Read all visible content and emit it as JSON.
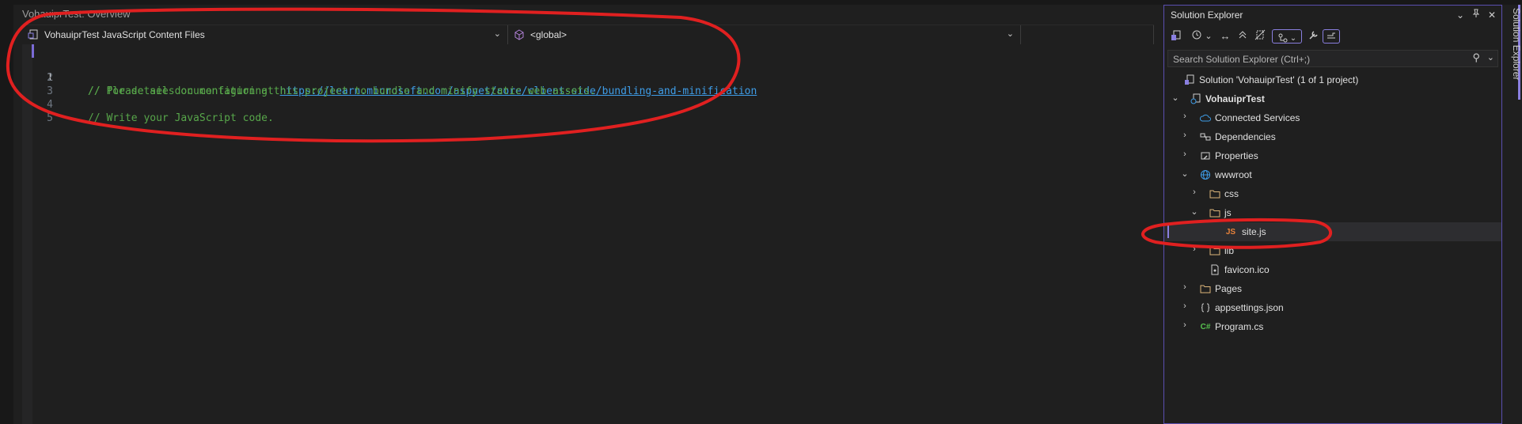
{
  "editor": {
    "title": "VohauiprTest: Overview",
    "nav": {
      "project": "VohauiprTest JavaScript Content Files",
      "scope": "<global>",
      "member": ""
    },
    "lines": [
      {
        "num": "1",
        "text": "// Please see documentation at ",
        "url": "https://learn.microsoft.com/aspnet/core/client-side/bundling-and-minification"
      },
      {
        "num": "2",
        "text": "// for details on configuring this project to bundle and minify static web assets.",
        "url": ""
      },
      {
        "num": "3",
        "text": "",
        "url": ""
      },
      {
        "num": "4",
        "text": "// Write your JavaScript code.",
        "url": ""
      },
      {
        "num": "5",
        "text": "",
        "url": ""
      }
    ]
  },
  "solution_explorer": {
    "title": "Solution Explorer",
    "search_placeholder": "Search Solution Explorer (Ctrl+;)",
    "side_tab": "Solution Explorer",
    "tree": {
      "solution": "Solution 'VohauiprTest' (1 of 1 project)",
      "project": "VohauiprTest",
      "connected_services": "Connected Services",
      "dependencies": "Dependencies",
      "properties": "Properties",
      "wwwroot": "wwwroot",
      "css": "css",
      "js": "js",
      "site_js": "site.js",
      "lib": "lib",
      "favicon": "favicon.ico",
      "pages": "Pages",
      "appsettings": "appsettings.json",
      "program": "Program.cs"
    },
    "icon_labels": {
      "js_file": "JS",
      "cs_file": "C#"
    }
  },
  "colors": {
    "accent": "#8a7fe0",
    "comment": "#57a64a",
    "link": "#3e9ce6",
    "annotation": "#e02020"
  }
}
